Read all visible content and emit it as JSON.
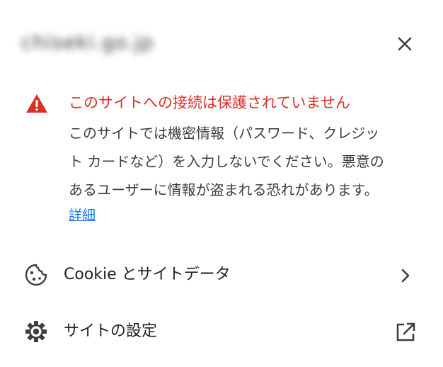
{
  "header": {
    "site_host": "chiseki.go.jp",
    "close_icon": "close-icon"
  },
  "warning": {
    "icon": "warning-triangle-icon",
    "title": "このサイトへの接続は保護されていません",
    "title_color": "#d93025",
    "description_lines": [
      "このサイトでは機密情報（パスワード、クレジッ",
      "ト カードなど）を入力しないでください。悪意の",
      "あるユーザーに情報が盗まれる恐れがあります。"
    ],
    "details_link": "詳細",
    "link_color": "#1a73e8"
  },
  "menu": {
    "items": [
      {
        "icon": "cookie-icon",
        "label": "Cookie とサイトデータ",
        "trailing_icon": "chevron-right-icon"
      },
      {
        "icon": "gear-icon",
        "label": "サイトの設定",
        "trailing_icon": "external-link-icon"
      }
    ]
  }
}
